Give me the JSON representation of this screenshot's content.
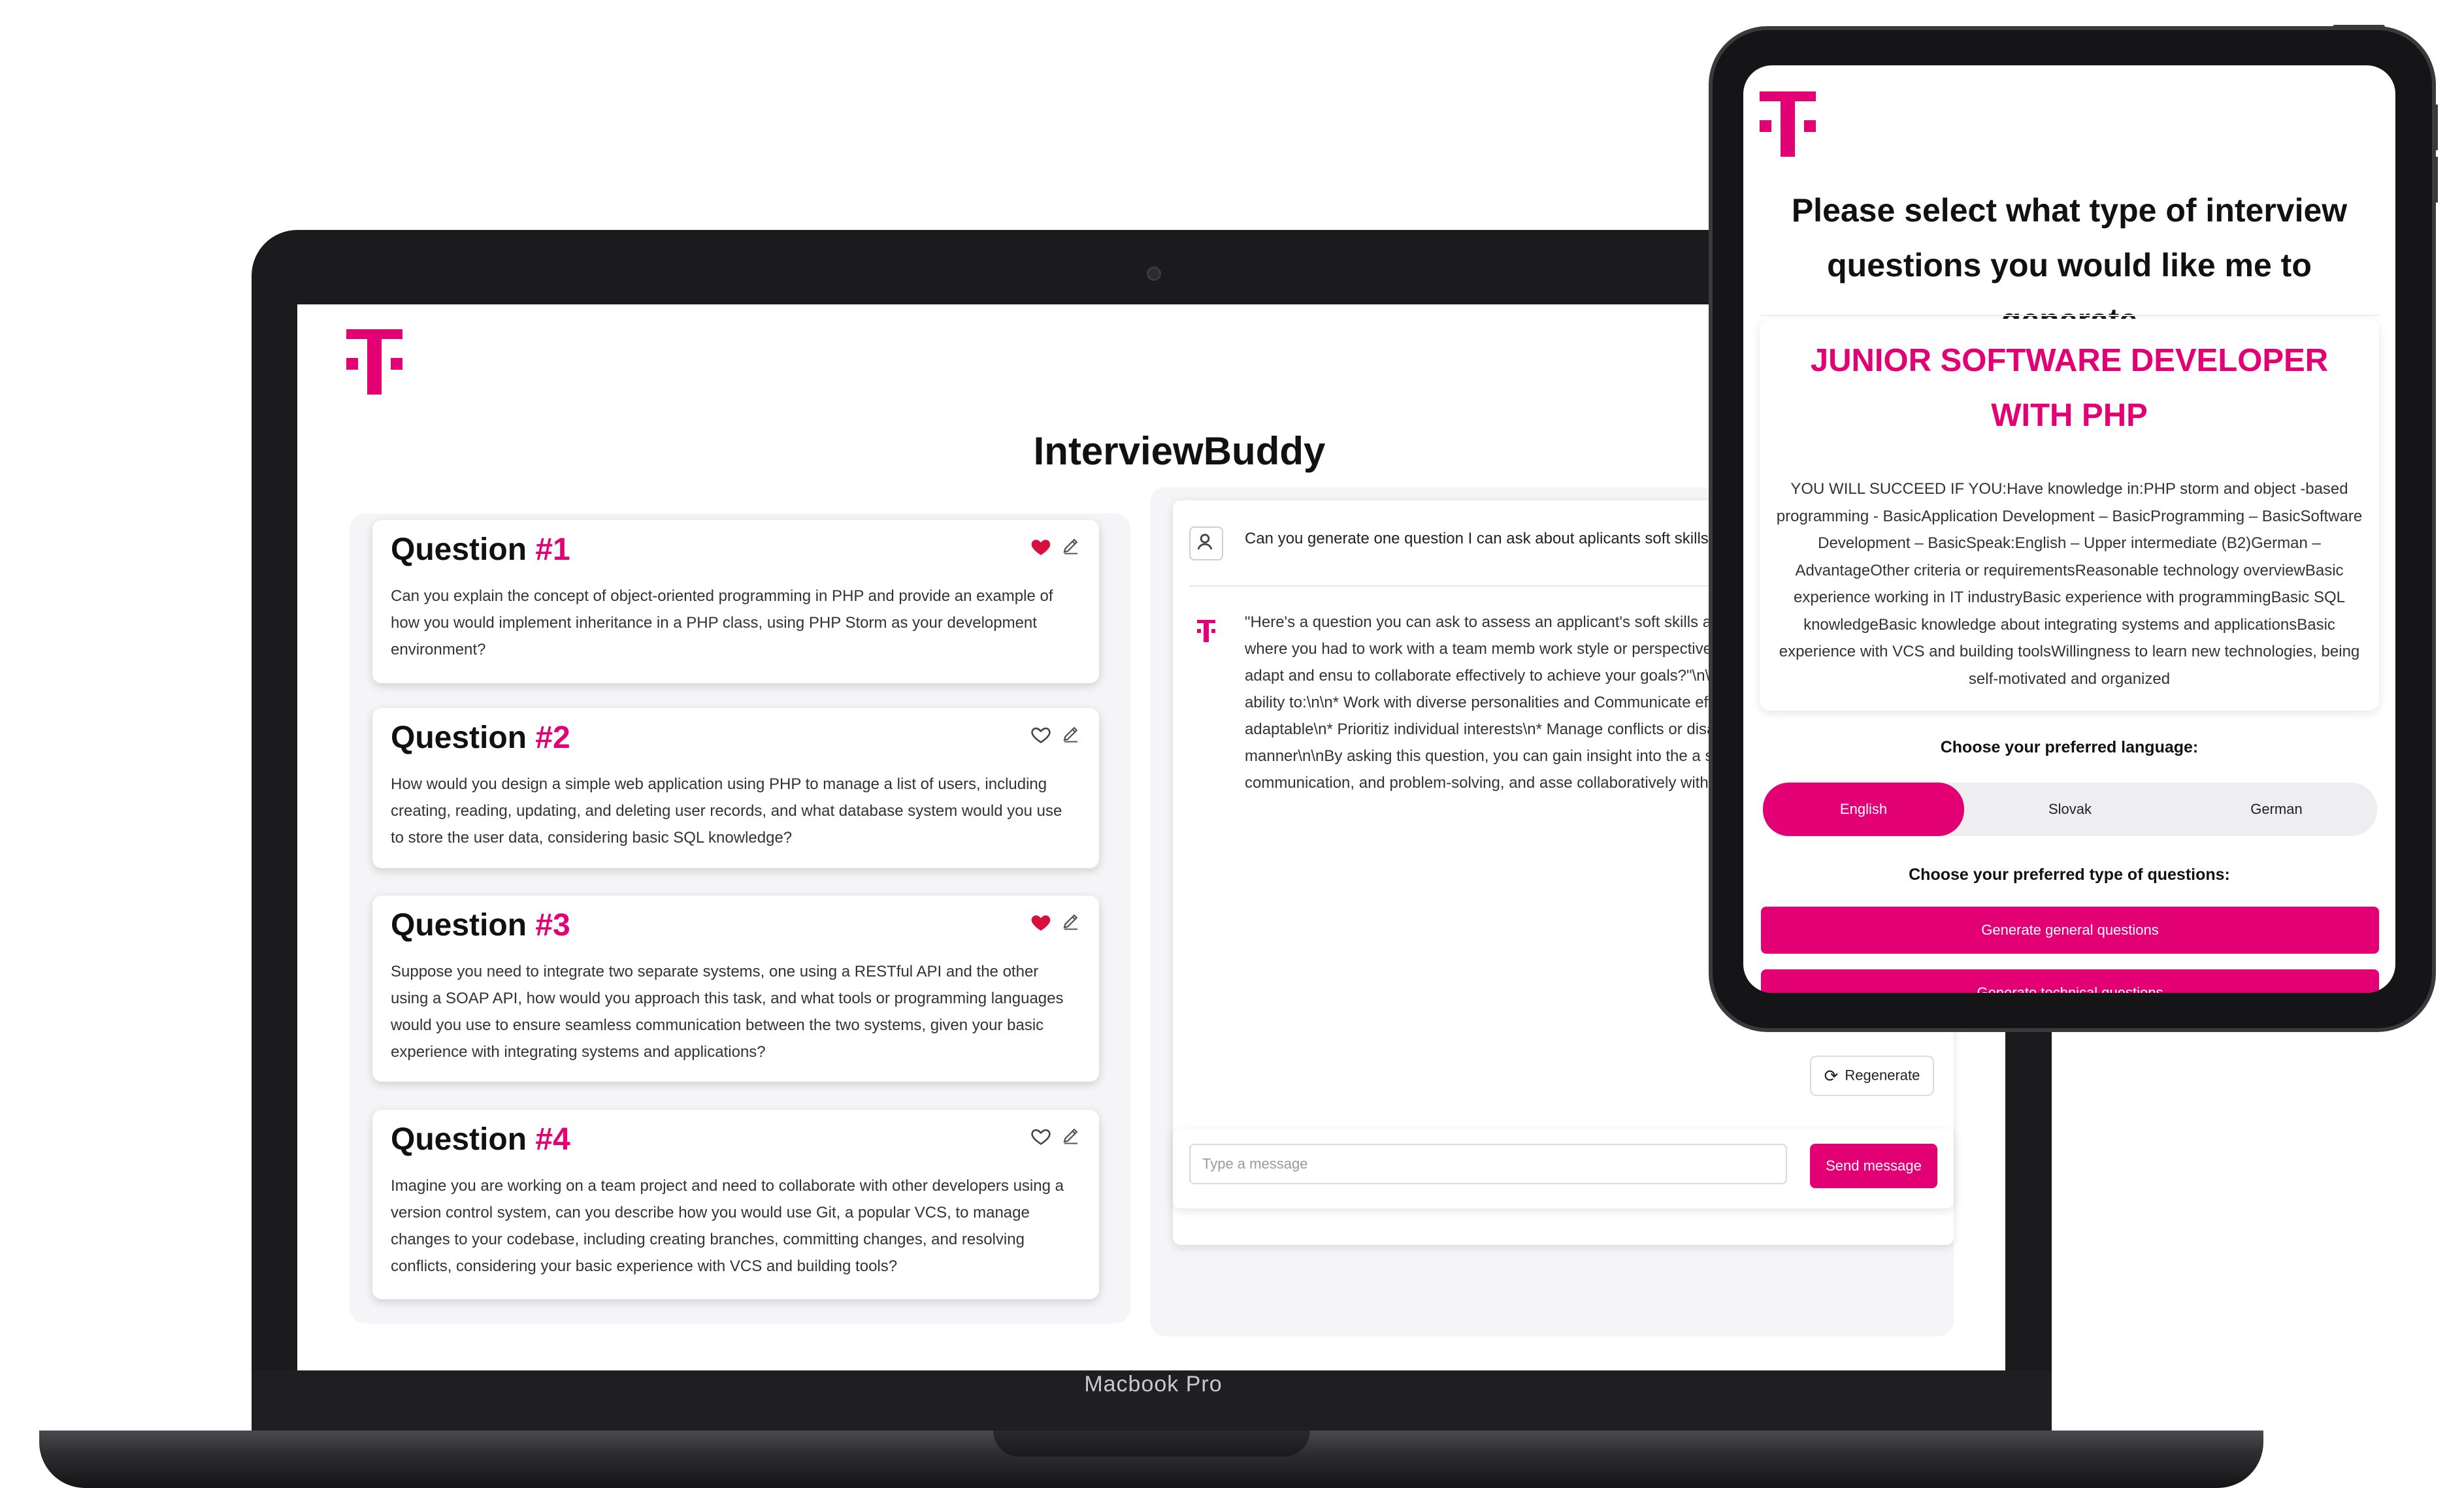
{
  "brand": {
    "accent": "#e20074"
  },
  "laptop": {
    "model_label": "Macbook Pro",
    "app": {
      "title": "InterviewBuddy",
      "questions": [
        {
          "label": "Question ",
          "number": "#1",
          "favorited": true,
          "text": "Can you explain the concept of object-oriented programming in PHP and provide an example of how you would implement inheritance in a PHP class, using PHP Storm as your development environment?"
        },
        {
          "label": "Question ",
          "number": "#2",
          "favorited": false,
          "text": "How would you design a simple web application using PHP to manage a list of users, including creating, reading, updating, and deleting user records, and what database system would you use to store the user data, considering basic SQL knowledge?"
        },
        {
          "label": "Question ",
          "number": "#3",
          "favorited": true,
          "text": "Suppose you need to integrate two separate systems, one using a RESTful API and the other using a SOAP API, how would you approach this task, and what tools or programming languages would you use to ensure seamless communication between the two systems, given your basic experience with integrating systems and applications?"
        },
        {
          "label": "Question ",
          "number": "#4",
          "favorited": false,
          "text": "Imagine you are working on a team project and need to collaborate with other developers using a version control system, can you describe how you would use Git, a popular VCS, to manage changes to your codebase, including creating branches, committing changes, and resolving conflicts, considering your basic experience with VCS and building tools?"
        }
      ],
      "chat": {
        "user_message": "Can you generate one question I can ask about aplicants soft skills",
        "bot_message": "\"Here's a question you can ask to assess an applicant's soft skills a you describe a situation where you had to work with a team memb work style or perspective than yours? How did you adapt and ensu to collaborate effectively to achieve your goals?\"\\n\\nThis question the applicant's ability to:\\n\\n* Work with diverse personalities and Communicate effectively\\n* Be flexible and adaptable\\n* Prioritiz individual interests\\n* Manage conflicts or disagreements in a con manner\\n\\nBy asking this question, you can gain insight into the a such as teamwork, communication, and problem-solving, and asse collaboratively with others.\"",
        "regenerate_label": "Regenerate",
        "input_placeholder": "Type a message",
        "send_label": "Send message"
      }
    }
  },
  "tablet": {
    "heading": "Please select what type of interview questions you would like me to generate",
    "job_title": "JUNIOR SOFTWARE DEVELOPER WITH PHP",
    "job_description": "YOU WILL SUCCEED IF YOU:Have knowledge in:PHP storm and object -based programming - BasicApplication Development – BasicProgramming – BasicSoftware Development – BasicSpeak:English – Upper intermediate (B2)German – AdvantageOther criteria or requirementsReasonable technology overviewBasic experience working in IT industryBasic experience with programmingBasic SQL knowledgeBasic knowledge about integrating systems and applicationsBasic experience with VCS and building toolsWillingness to learn new technologies, being self-motivated and organized",
    "language_label": "Choose your preferred language:",
    "languages": [
      "English",
      "Slovak",
      "German"
    ],
    "selected_language": "English",
    "type_label": "Choose your preferred type of questions:",
    "buttons": [
      "Generate general questions",
      "Generate technical questions"
    ]
  }
}
